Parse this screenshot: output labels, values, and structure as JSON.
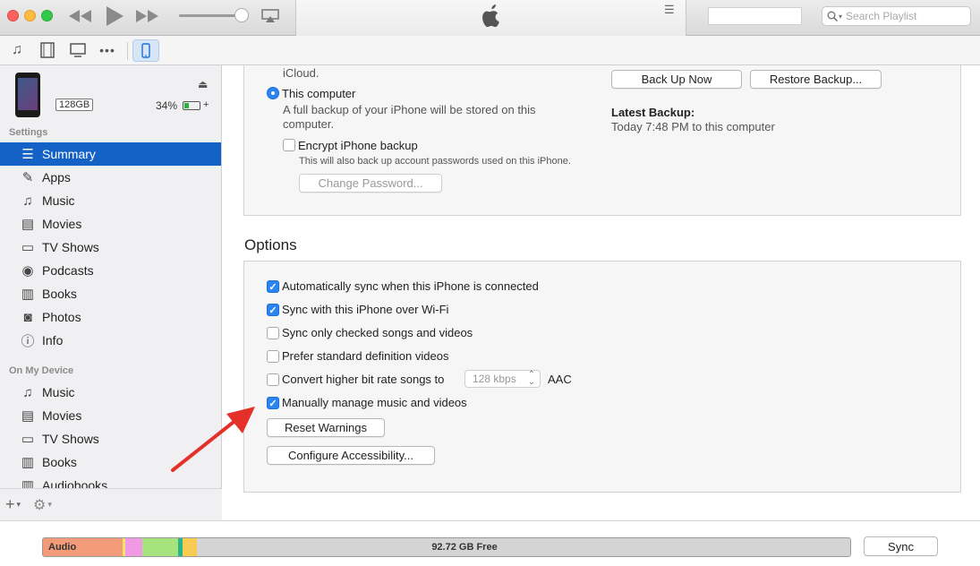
{
  "search": {
    "placeholder": "Search Playlist"
  },
  "device": {
    "capacity": "128GB",
    "battery_pct": "34%",
    "battery_level": 0.34
  },
  "sidebar": {
    "settings_header": "Settings",
    "settings_items": [
      {
        "label": "Summary",
        "icon": "list-icon"
      },
      {
        "label": "Apps",
        "icon": "apps-icon"
      },
      {
        "label": "Music",
        "icon": "music-note-icon"
      },
      {
        "label": "Movies",
        "icon": "film-icon"
      },
      {
        "label": "TV Shows",
        "icon": "tv-icon"
      },
      {
        "label": "Podcasts",
        "icon": "podcast-icon"
      },
      {
        "label": "Books",
        "icon": "book-icon"
      },
      {
        "label": "Photos",
        "icon": "camera-icon"
      },
      {
        "label": "Info",
        "icon": "info-icon"
      }
    ],
    "ondevice_header": "On My Device",
    "ondevice_items": [
      {
        "label": "Music",
        "icon": "music-note-icon"
      },
      {
        "label": "Movies",
        "icon": "film-icon"
      },
      {
        "label": "TV Shows",
        "icon": "tv-icon"
      },
      {
        "label": "Books",
        "icon": "book-icon"
      },
      {
        "label": "Audiobooks",
        "icon": "audiobook-icon"
      }
    ]
  },
  "backup": {
    "icloud_tail": "iCloud.",
    "this_computer": "This computer",
    "this_computer_desc_1": "A full backup of your iPhone will be stored on this",
    "this_computer_desc_2": "computer.",
    "encrypt_label": "Encrypt iPhone backup",
    "encrypt_desc": "This will also back up account passwords used on this iPhone.",
    "change_password": "Change Password...",
    "back_up_now": "Back Up Now",
    "restore_backup": "Restore Backup...",
    "latest_backup_title": "Latest Backup:",
    "latest_backup_value": "Today 7:48 PM to this computer"
  },
  "options": {
    "title": "Options",
    "auto_sync": "Automatically sync when this iPhone is connected",
    "wifi_sync": "Sync with this iPhone over Wi-Fi",
    "checked_only": "Sync only checked songs and videos",
    "standard_def": "Prefer standard definition videos",
    "convert_bitrate": "Convert higher bit rate songs to",
    "bitrate_value": "128 kbps",
    "bitrate_format": "AAC",
    "manual_manage": "Manually manage music and videos",
    "reset_warnings": "Reset Warnings",
    "configure_accessibility": "Configure Accessibility..."
  },
  "storage": {
    "audio_label": "Audio",
    "free_label": "92.72 GB Free",
    "sync_button": "Sync"
  }
}
